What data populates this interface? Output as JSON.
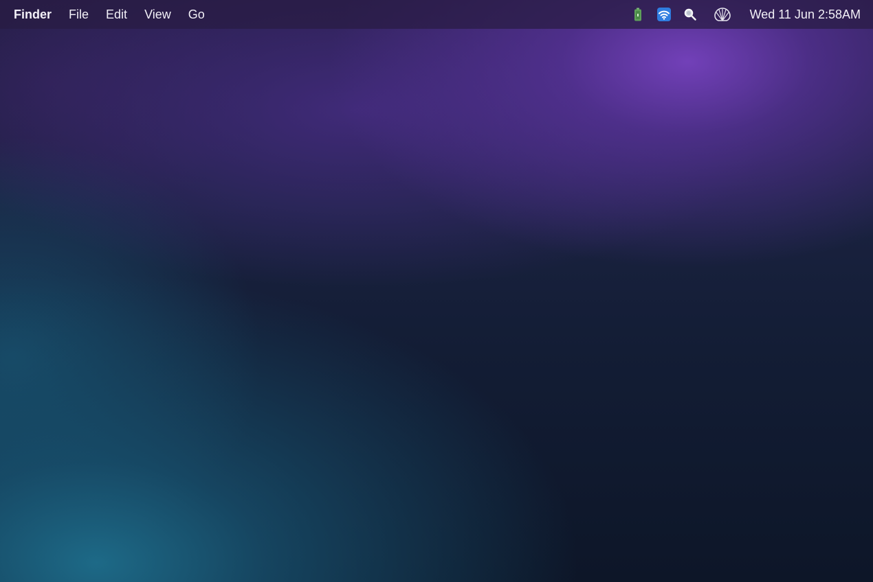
{
  "menubar": {
    "app_name": "Finder",
    "menus": [
      "File",
      "Edit",
      "View",
      "Go"
    ],
    "status_icons": [
      "battery-icon",
      "wifi-icon",
      "search-icon",
      "shell-icon"
    ],
    "clock": "Wed 11 Jun  2:58AM"
  },
  "colors": {
    "battery": "#5fa05a",
    "wifi_bg": "#2f7de0",
    "accent_purple": "#6a3fb0",
    "accent_teal": "#1e6e8c"
  }
}
